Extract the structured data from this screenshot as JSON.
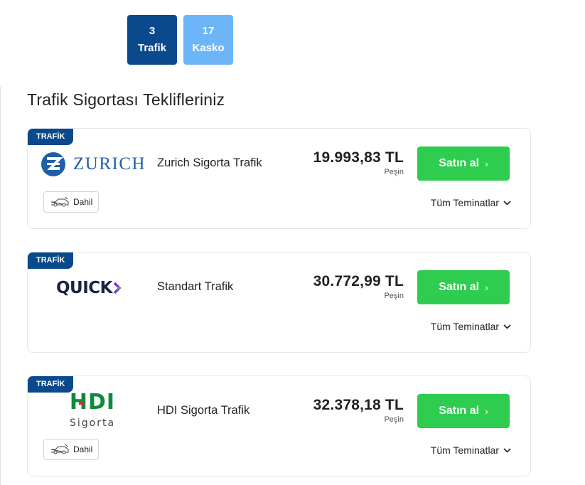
{
  "tabs": [
    {
      "count": "3",
      "label": "Trafik",
      "active": true
    },
    {
      "count": "17",
      "label": "Kasko",
      "active": false
    }
  ],
  "page_title": "Trafik Sigortası Teklifleriniz",
  "offers": [
    {
      "badge": "TRAFİK",
      "logo_text": "ZURICH",
      "logo_icon": "zurich-logo",
      "product": "Zurich Sigorta Trafik",
      "price": "19.993,83 TL",
      "payment": "Peşin",
      "buy_label": "Satın al",
      "dahil": "Dahil",
      "coverage_label": "Tüm Teminatlar"
    },
    {
      "badge": "TRAFİK",
      "logo_text": "QUICK",
      "logo_icon": "quick-logo",
      "product": "Standart Trafik",
      "price": "30.772,99 TL",
      "payment": "Peşin",
      "buy_label": "Satın al",
      "coverage_label": "Tüm Teminatlar"
    },
    {
      "badge": "TRAFİK",
      "logo_text": "HDI",
      "logo_subtext": "Sigorta",
      "logo_icon": "hdi-logo",
      "product": "HDI Sigorta Trafik",
      "price": "32.378,18 TL",
      "payment": "Peşin",
      "buy_label": "Satın al",
      "dahil": "Dahil",
      "coverage_label": "Tüm Teminatlar"
    }
  ],
  "colors": {
    "primary_navy": "#0a4a8c",
    "tab_inactive": "#6cb6f8",
    "buy_green": "#2ecc4f",
    "zurich_blue": "#1f5fa8",
    "quick_navy": "#1c2340",
    "quick_accent": "#8a2be2",
    "hdi_green": "#0f8a3a",
    "hdi_red": "#e3262e"
  }
}
